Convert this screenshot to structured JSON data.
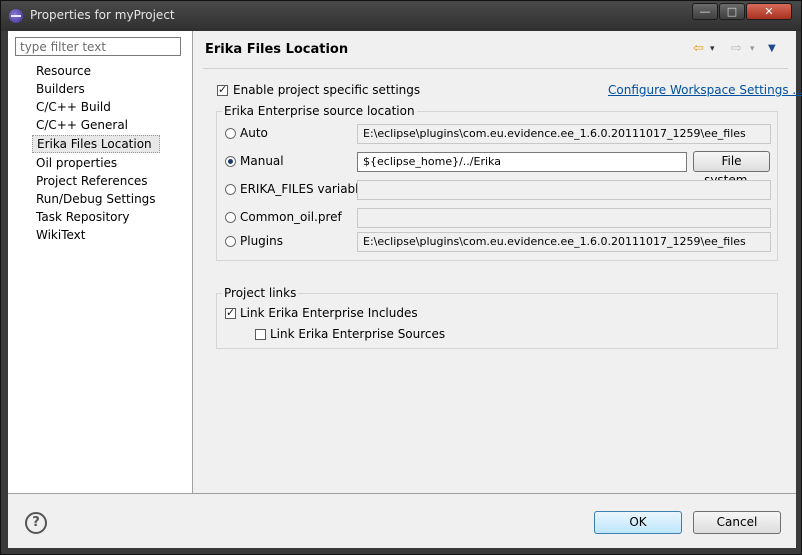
{
  "window": {
    "title": "Properties for myProject",
    "buttons": {
      "minimize": "—",
      "maximize": "□",
      "close": "✕"
    }
  },
  "sidebar": {
    "filter_placeholder": "type filter text",
    "items": [
      {
        "label": "Resource"
      },
      {
        "label": "Builders"
      },
      {
        "label": "C/C++ Build"
      },
      {
        "label": "C/C++ General"
      },
      {
        "label": "Erika Files Location",
        "selected": true
      },
      {
        "label": "Oil properties"
      },
      {
        "label": "Project References"
      },
      {
        "label": "Run/Debug Settings"
      },
      {
        "label": "Task Repository"
      },
      {
        "label": "WikiText"
      }
    ]
  },
  "page": {
    "title": "Erika Files Location",
    "nav": {
      "back_icon": "⇦",
      "forward_icon": "⇨",
      "dropdown_icon": "▾",
      "menu_icon": "▼"
    },
    "enable_specific": {
      "label": "Enable project specific settings",
      "checked": true
    },
    "configure_link": "Configure Workspace Settings ...",
    "source_group": {
      "title": "Erika Enterprise source location",
      "options": [
        {
          "label": "Auto",
          "value": "E:\\eclipse\\plugins\\com.eu.evidence.ee_1.6.0.20111017_1259\\ee_files",
          "checked": false
        },
        {
          "label": "Manual",
          "value": "${eclipse_home}/../Erika",
          "checked": true
        },
        {
          "label": "ERIKA_FILES variable",
          "value": "",
          "checked": false
        },
        {
          "label": "Common_oil.pref",
          "value": "",
          "checked": false
        },
        {
          "label": "Plugins",
          "value": "E:\\eclipse\\plugins\\com.eu.evidence.ee_1.6.0.20111017_1259\\ee_files",
          "checked": false
        }
      ],
      "file_system_button": "File system..."
    },
    "links_group": {
      "title": "Project links",
      "include_label": "Link Erika Enterprise Includes",
      "include_checked": true,
      "sources_label": "Link Erika Enterprise Sources",
      "sources_checked": false
    }
  },
  "footer": {
    "help_icon": "?",
    "ok": "OK",
    "cancel": "Cancel"
  }
}
